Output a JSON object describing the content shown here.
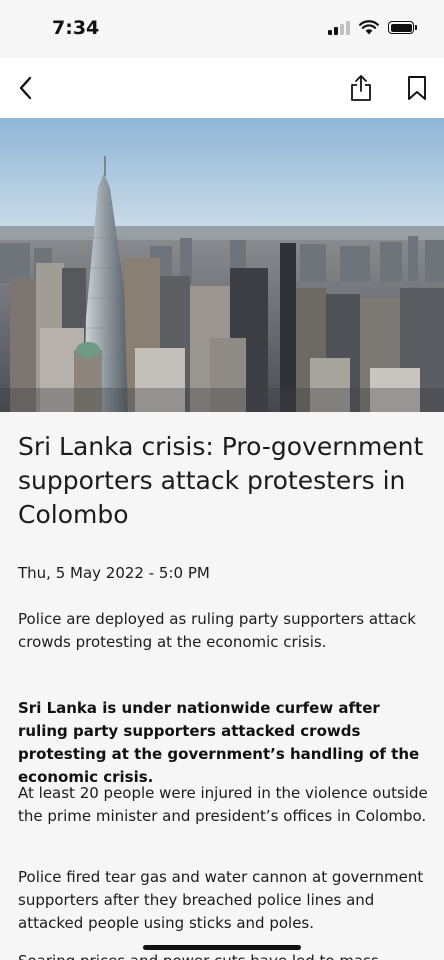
{
  "status_bar": {
    "time": "7:34",
    "icons": [
      "signal-icon",
      "wifi-icon",
      "battery-icon"
    ]
  },
  "nav": {
    "back_icon": "chevron-left-icon",
    "share_icon": "share-icon",
    "bookmark_icon": "bookmark-icon"
  },
  "hero": {
    "description_icon": "city-skyline-photo"
  },
  "article": {
    "headline": "Sri Lanka crisis: Pro-government supporters attack protesters in Colombo",
    "date": "Thu, 5 May 2022 - 5:0 PM",
    "summary": "Police are deployed as ruling party supporters attack crowds protesting at the economic crisis.",
    "lead": "Sri Lanka is under nationwide curfew after ruling party supporters attacked crowds protesting at the government’s handling of the economic crisis.",
    "paragraphs": [
      "At least 20 people were injured in the violence outside the prime minister and president’s offices in Colombo.",
      "Police fired tear gas and water cannon at government supporters after they breached police lines and attacked people using sticks and poles.",
      "Soaring prices and power cuts have led to mass"
    ]
  },
  "colors": {
    "background": "#f6f6f6",
    "text": "#1c1c1c",
    "sky": "#b9d3e6"
  }
}
